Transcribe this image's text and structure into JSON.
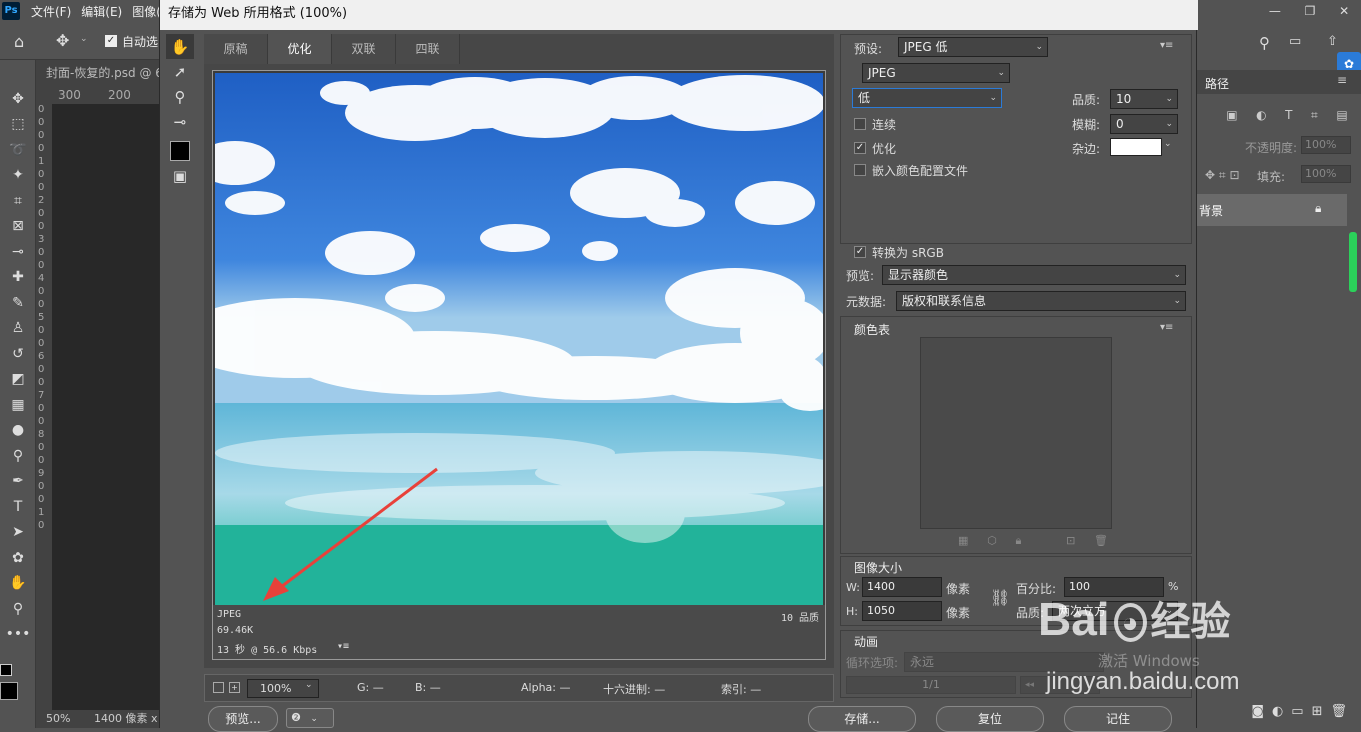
{
  "ps": {
    "logo": "Ps",
    "menu": [
      "文件(F)",
      "编辑(E)",
      "图像(I"
    ],
    "auto_select_label": "自动选",
    "doc_tab": "封面-恢复的.psd @ 6",
    "ruler_marks": [
      "300",
      "200"
    ],
    "ruler_v": [
      "0",
      "0",
      "0",
      "0",
      "1",
      "0",
      "0",
      "2",
      "0",
      "0",
      "3",
      "0",
      "0",
      "4",
      "0",
      "0",
      "5",
      "0",
      "0",
      "6",
      "0",
      "0",
      "7",
      "0",
      "0",
      "8",
      "0",
      "0",
      "9",
      "0",
      "0",
      "1",
      "0"
    ],
    "zoom": "50%",
    "size": "1400 像素 x 1",
    "right": {
      "paths_tab": "路径",
      "opacity_label": "不透明度:",
      "opacity_value": "100%",
      "fill_label": "填充:",
      "fill_value": "100%",
      "layer_name": "背景",
      "watermark": "激活 Windows"
    }
  },
  "dialog": {
    "title": "存储为 Web 所用格式 (100%)",
    "tabs": [
      "原稿",
      "优化",
      "双联",
      "四联"
    ],
    "active_tab": 1,
    "image_info": {
      "format": "JPEG",
      "size": "69.46K",
      "time": "13 秒 @ 56.6 Kbps",
      "quality": "10 品质"
    },
    "bottom": {
      "zoom": "100%",
      "g_label": "G: —",
      "b_label": "B: —",
      "alpha_label": "Alpha: —",
      "hex_label": "十六进制: —",
      "index_label": "索引: —"
    },
    "buttons": {
      "preview": "预览...",
      "save": "存储...",
      "reset": "复位",
      "remember": "记住"
    },
    "settings": {
      "preset_label": "预设:",
      "preset_value": "JPEG 低",
      "format_value": "JPEG",
      "quality_level": "低",
      "quality_label": "品质:",
      "quality_value": "10",
      "progressive_label": "连续",
      "blur_label": "模糊:",
      "blur_value": "0",
      "optimized_label": "优化",
      "matte_label": "杂边:",
      "embed_label": "嵌入颜色配置文件",
      "srgb_label": "转换为 sRGB",
      "preview_label": "预览:",
      "preview_value": "显示器颜色",
      "metadata_label": "元数据:",
      "metadata_value": "版权和联系信息",
      "color_table_title": "颜色表",
      "image_size_title": "图像大小",
      "w_label": "W:",
      "w_value": "1400",
      "h_label": "H:",
      "h_value": "1050",
      "px_unit": "像素",
      "percent_label": "百分比:",
      "percent_value": "100",
      "percent_unit": "%",
      "resample_label": "品质:",
      "resample_value": "两次立方",
      "anim_title": "动画",
      "loop_label": "循环选项:",
      "loop_value": "永远",
      "frame_counter": "1/1"
    }
  },
  "watermark": {
    "brand": "Bai",
    "brand2": "经验",
    "url": "jingyan.baidu.com"
  },
  "colors": {
    "accent": "#2b7bd8",
    "sky": "#2f6fd1",
    "sea": "#25b59d"
  }
}
